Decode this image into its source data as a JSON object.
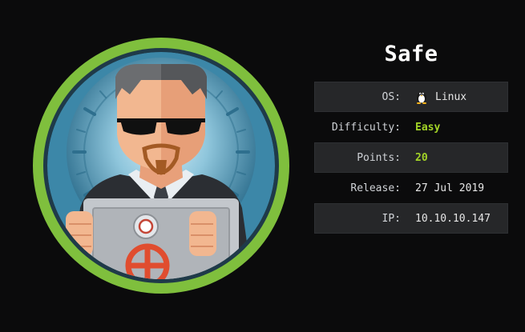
{
  "machine": {
    "name": "Safe"
  },
  "info": {
    "os_label": "OS:",
    "os_value": "Linux",
    "os_icon": "tux-penguin-icon",
    "difficulty_label": "Difficulty:",
    "difficulty_value": "Easy",
    "points_label": "Points:",
    "points_value": "20",
    "release_label": "Release:",
    "release_value": "27 Jul 2019",
    "ip_label": "IP:",
    "ip_value": "10.10.10.147"
  },
  "colors": {
    "background": "#0b0b0c",
    "ring": "#8bc43f",
    "accent": "#a2d327",
    "row_shade": "#262729"
  }
}
